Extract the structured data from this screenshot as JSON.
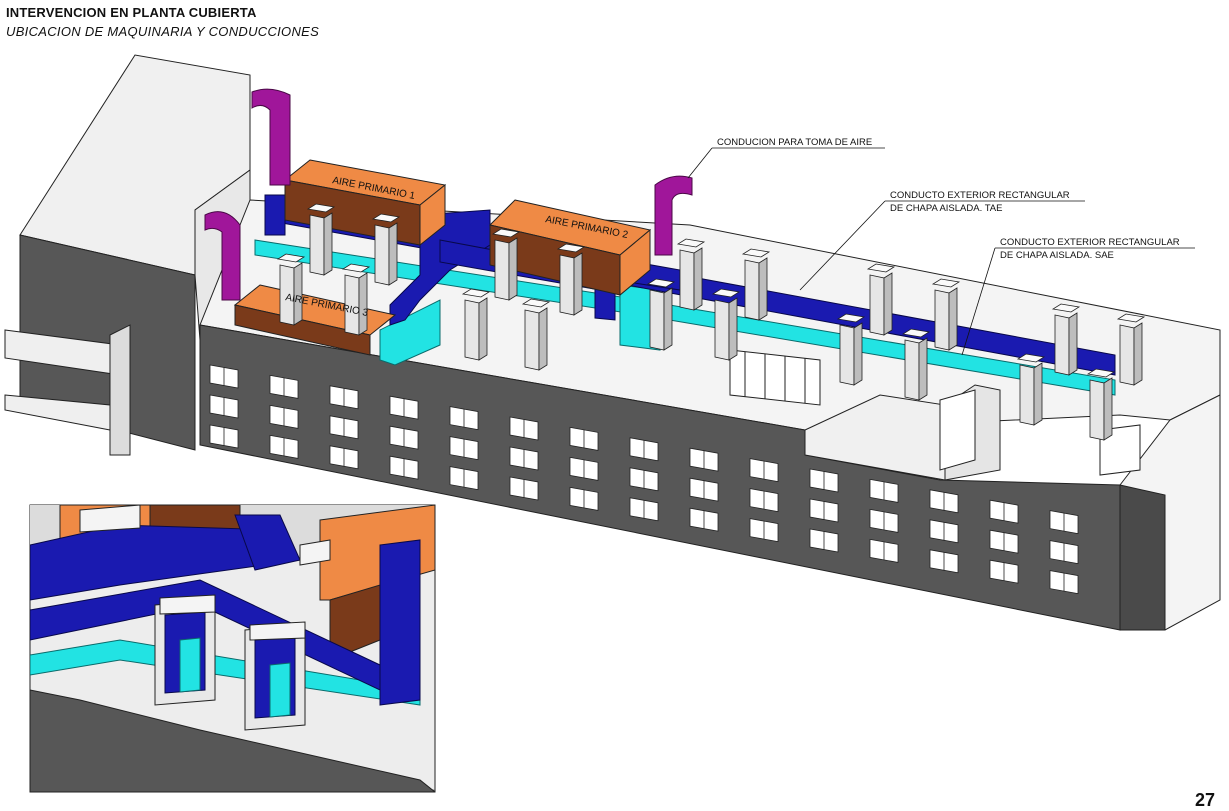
{
  "header": {
    "title": "INTERVENCION EN PLANTA CUBIERTA",
    "subtitle": "UBICACION DE MAQUINARIA Y CONDUCCIONES"
  },
  "units": {
    "u1": "AIRE PRIMARIO 1",
    "u2": "AIRE PRIMARIO 2",
    "u3": "AIRE PRIMARIO 3"
  },
  "callouts": {
    "intake": "CONDUCION PARA TOMA DE AIRE",
    "tae_line1": "CONDUCTO EXTERIOR RECTANGULAR",
    "tae_line2": "DE CHAPA AISLADA. TAE",
    "sae_line1": "CONDUCTO EXTERIOR RECTANGULAR",
    "sae_line2": "DE CHAPA AISLADA. SAE"
  },
  "page_number": "27",
  "colors": {
    "wall": "#575757",
    "wall_dark": "#454545",
    "roof": "#f2f2f2",
    "duct_supply": "#1a1ab0",
    "duct_extract": "#22e3e3",
    "unit_orange": "#ef8a45",
    "unit_brown": "#7a3a1a",
    "intake_magenta": "#a0169a",
    "window": "#ffffff"
  }
}
